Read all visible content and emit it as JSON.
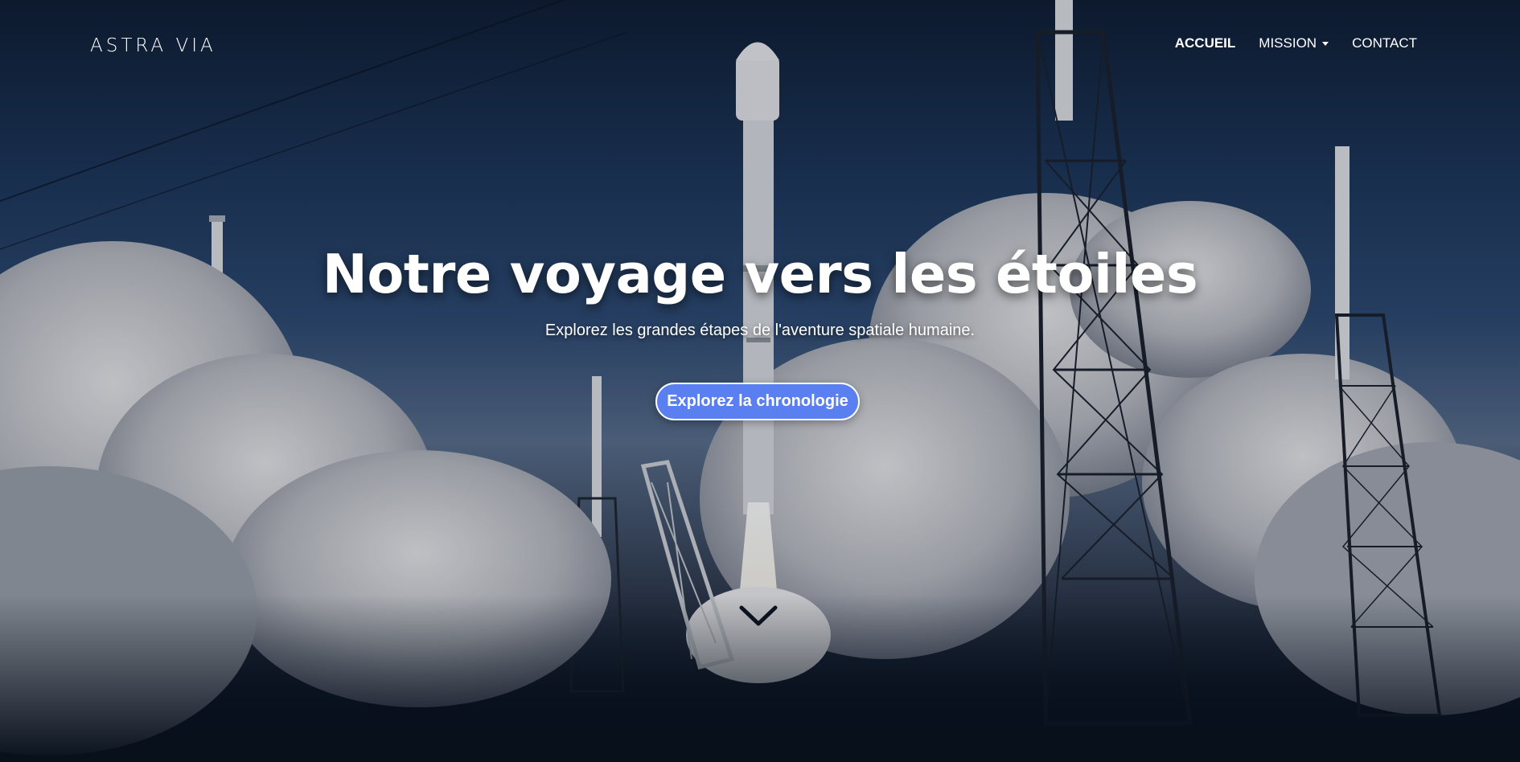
{
  "brand": {
    "logo_text": "ASTRA VIA"
  },
  "nav": {
    "items": [
      {
        "label": "ACCUEIL",
        "active": true
      },
      {
        "label": "MISSION",
        "dropdown": true
      },
      {
        "label": "CONTACT"
      }
    ]
  },
  "hero": {
    "title": "Notre voyage vers les étoiles",
    "subtitle": "Explorez les grandes étapes de l'aventure spatiale humaine.",
    "cta_label": "Explorez la chronologie",
    "scroll_icon": "chevron-down-icon",
    "background_image": "rocket-launch-photo"
  },
  "colors": {
    "accent": "#5a7ff0",
    "text": "#ffffff",
    "sky_dark": "#0f1d33",
    "ground_dark": "#08101c"
  }
}
